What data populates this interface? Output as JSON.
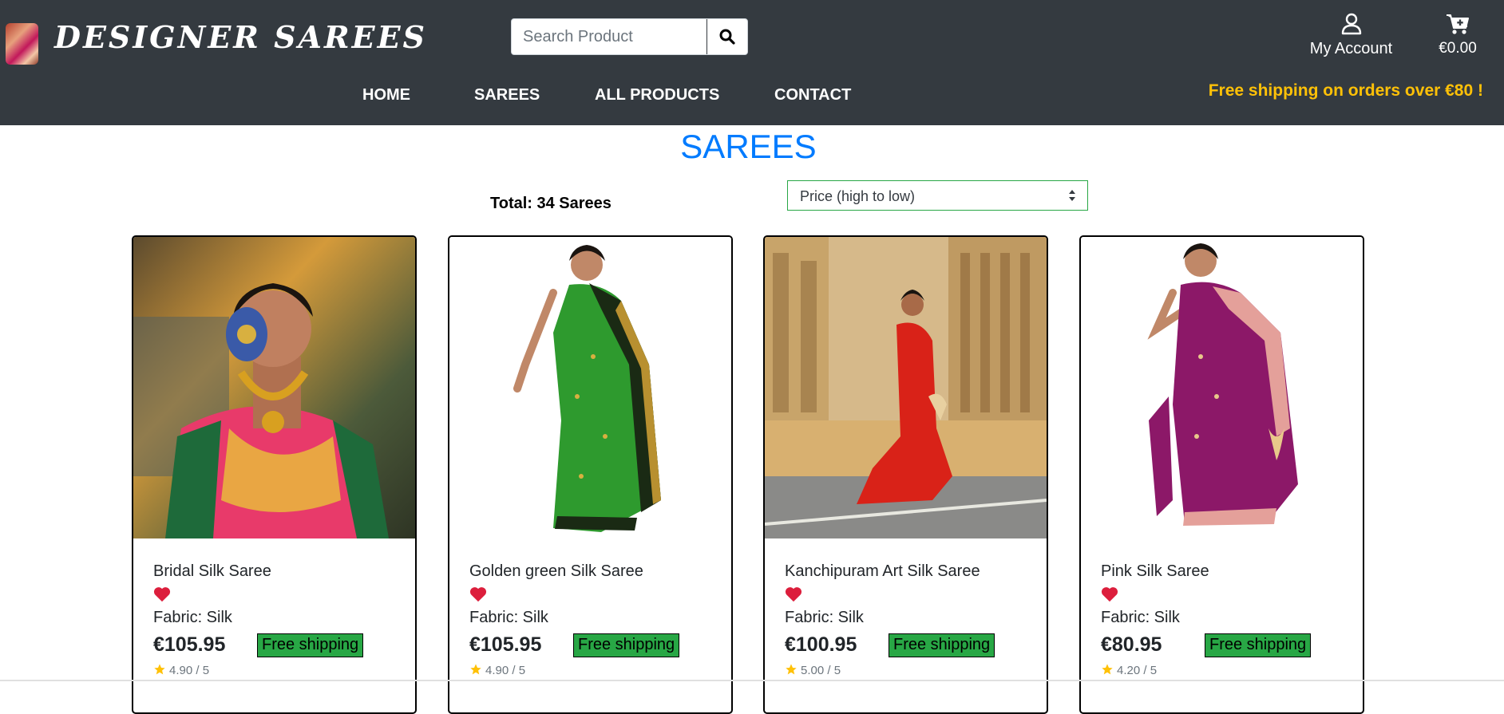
{
  "brand": {
    "name": "DESIGNER SAREES"
  },
  "search": {
    "placeholder": "Search Product"
  },
  "account": {
    "label": "My Account"
  },
  "cart": {
    "total": "€0.00"
  },
  "nav": {
    "items": [
      "HOME",
      "SAREES",
      "ALL PRODUCTS",
      "CONTACT"
    ]
  },
  "promo": "Free shipping on orders over €80 !",
  "page": {
    "title": "SAREES",
    "total": "Total: 34 Sarees"
  },
  "sort": {
    "selected": "Price (high to low)"
  },
  "colors": {
    "navbar": "#343a40",
    "title": "#007bff",
    "promo": "#ffc107",
    "shipping_badge": "#28a745",
    "heart": "#dc1e3c",
    "star": "#ffc107"
  },
  "products": [
    {
      "name": "Bridal Silk Saree",
      "fabric": "Fabric: Silk",
      "price": "€105.95",
      "shipping": "Free shipping",
      "rating": "4.90 / 5"
    },
    {
      "name": "Golden green Silk Saree",
      "fabric": "Fabric: Silk",
      "price": "€105.95",
      "shipping": "Free shipping",
      "rating": "4.90 / 5"
    },
    {
      "name": "Kanchipuram Art Silk Saree",
      "fabric": "Fabric: Silk",
      "price": "€100.95",
      "shipping": "Free shipping",
      "rating": "5.00 / 5"
    },
    {
      "name": "Pink Silk Saree",
      "fabric": "Fabric: Silk",
      "price": "€80.95",
      "shipping": "Free shipping",
      "rating": "4.20 / 5"
    }
  ]
}
